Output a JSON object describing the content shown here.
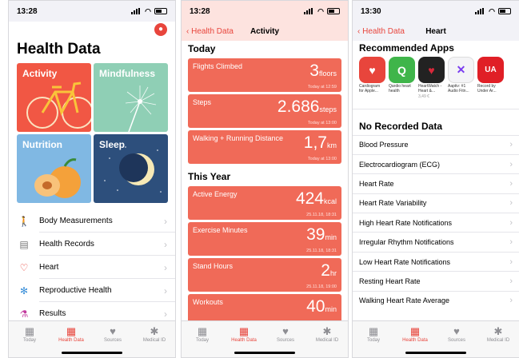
{
  "status": {
    "p1_time": "13:28",
    "p2_time": "13:28",
    "p3_time": "13:30"
  },
  "screen1": {
    "title": "Health Data",
    "tiles": [
      {
        "label": "Activity",
        "color": "#f15744"
      },
      {
        "label": "Mindfulness",
        "color": "#8fcfb5"
      },
      {
        "label": "Nutrition",
        "color": "#80b8e3"
      },
      {
        "label": "Sleep",
        "color": "#2d4f7c"
      }
    ],
    "categories": [
      {
        "label": "Body Measurements",
        "icon": "person-icon"
      },
      {
        "label": "Health Records",
        "icon": "clipboard-icon"
      },
      {
        "label": "Heart",
        "icon": "heart-icon"
      },
      {
        "label": "Reproductive Health",
        "icon": "snowflake-icon"
      },
      {
        "label": "Results",
        "icon": "flask-icon"
      }
    ]
  },
  "screen2": {
    "back": "Health Data",
    "title": "Activity",
    "section_today": "Today",
    "section_year": "This Year",
    "today": [
      {
        "label": "Flights Climbed",
        "value": "3",
        "unit": "floors",
        "date": "Today at 12:59"
      },
      {
        "label": "Steps",
        "value": "2.686",
        "unit": "steps",
        "date": "Today at 13:00"
      },
      {
        "label": "Walking + Running Distance",
        "value": "1,7",
        "unit": "km",
        "date": "Today at 13:00"
      }
    ],
    "year": [
      {
        "label": "Active Energy",
        "value": "424",
        "unit": "kcal",
        "date": "25.11.18, 18:31"
      },
      {
        "label": "Exercise Minutes",
        "value": "39",
        "unit": "min",
        "date": "25.11.18, 18:31"
      },
      {
        "label": "Stand Hours",
        "value": "2",
        "unit": "hr",
        "date": "25.11.18, 19:00"
      },
      {
        "label": "Workouts",
        "value": "40",
        "unit": "min",
        "date": ""
      }
    ]
  },
  "screen3": {
    "back": "Health Data",
    "title": "Heart",
    "recommended": "Recommended Apps",
    "apps": [
      {
        "name": "Cardiogram for Apple...",
        "price": "",
        "color": "#e8453c",
        "glyph": "♥"
      },
      {
        "name": "Qardio heart health",
        "price": "",
        "color": "#3fb54a",
        "glyph": "Q"
      },
      {
        "name": "HeartWatch - Heart &...",
        "price": "3,49 €",
        "color": "#d8283a",
        "glyph": "♥"
      },
      {
        "name": "Aaptiv: #1 Audio Fitn...",
        "price": "",
        "color": "#f4f4f6",
        "glyph": "✕"
      },
      {
        "name": "Record by Under Ar...",
        "price": "",
        "color": "#e01f26",
        "glyph": "UA"
      }
    ],
    "no_data": "No Recorded Data",
    "rows": [
      "Blood Pressure",
      "Electrocardiogram (ECG)",
      "Heart Rate",
      "Heart Rate Variability",
      "High Heart Rate Notifications",
      "Irregular Rhythm Notifications",
      "Low Heart Rate Notifications",
      "Resting Heart Rate",
      "Walking Heart Rate Average"
    ]
  },
  "tabbar": [
    "Today",
    "Health Data",
    "Sources",
    "Medical ID"
  ],
  "colors": {
    "accent": "#e8453c",
    "card": "#f06a58"
  }
}
